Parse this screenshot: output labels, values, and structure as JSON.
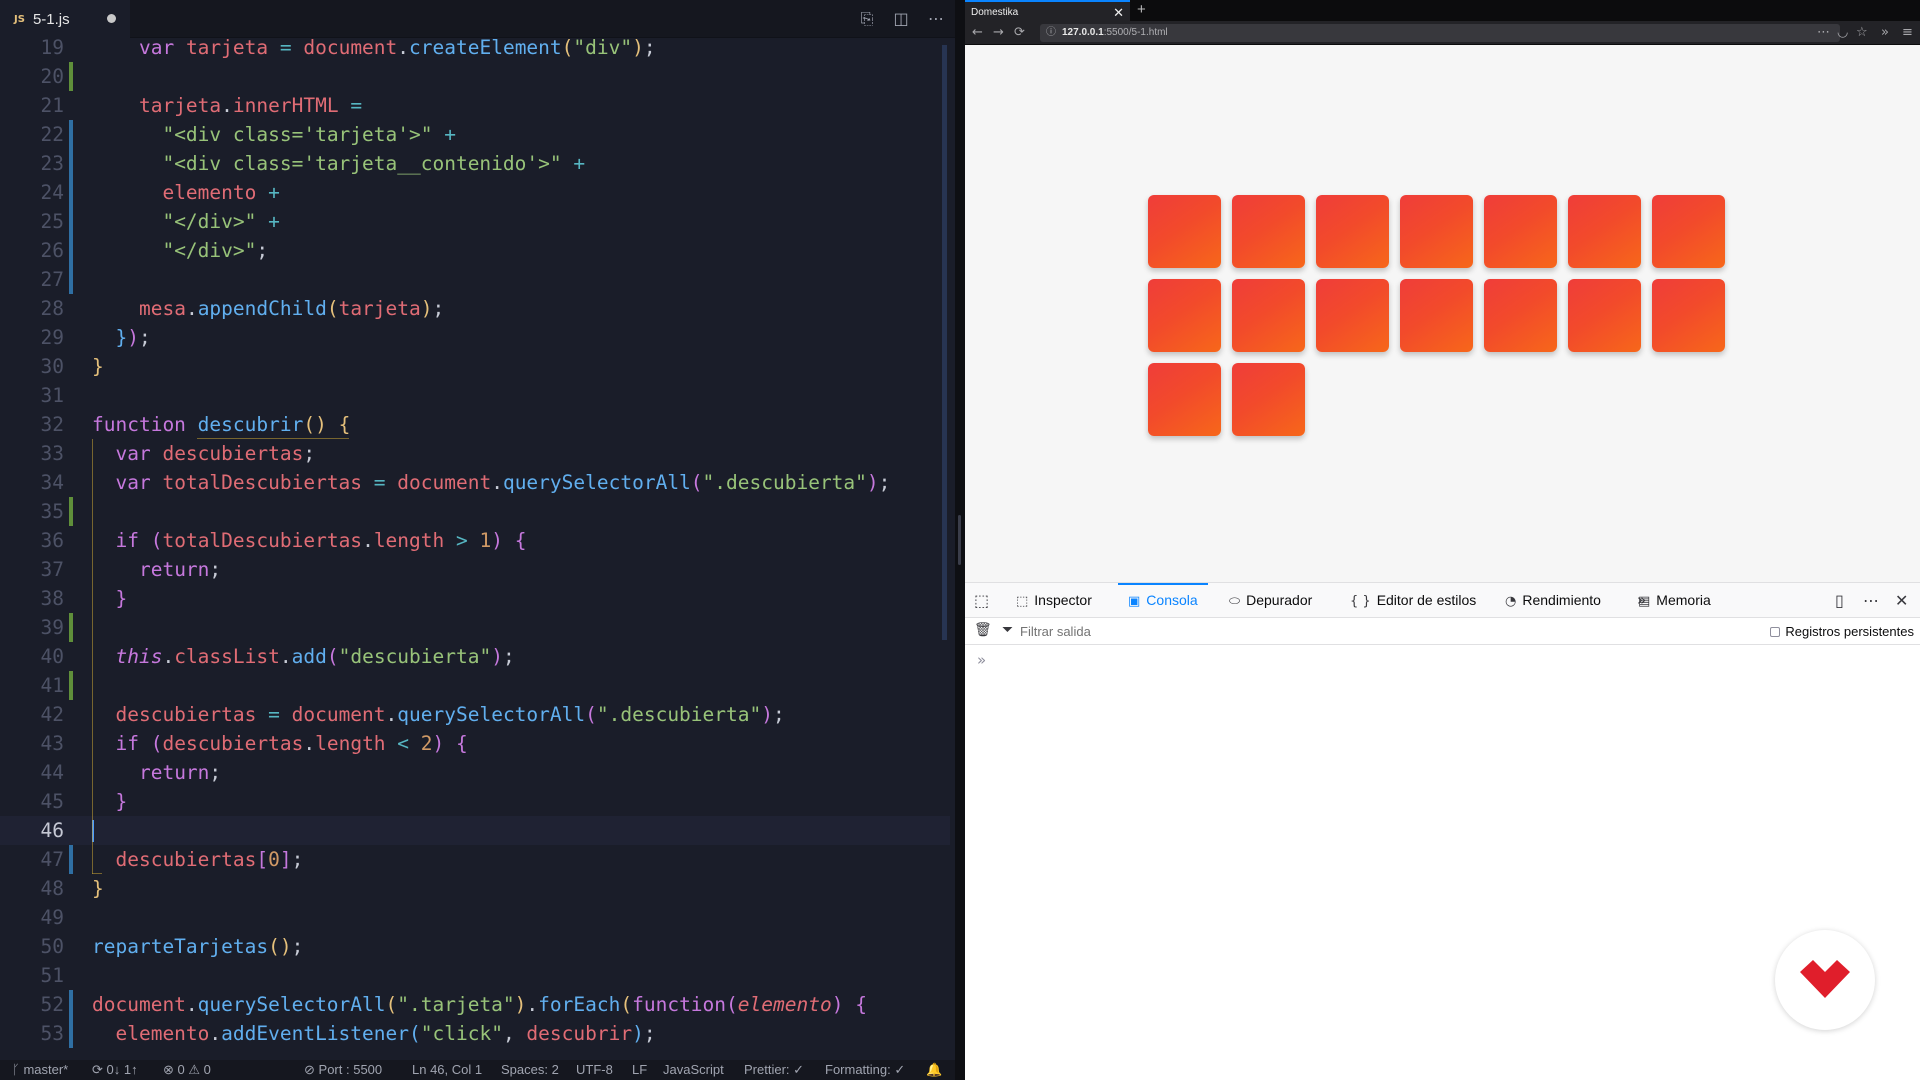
{
  "editor": {
    "tab_label": "5-1.js",
    "tab_badge": "JS",
    "tab_modified": true,
    "cursor_line": 46,
    "lines": [
      {
        "n": "19",
        "t": ""
      },
      {
        "n": "20",
        "t": ""
      },
      {
        "n": "21",
        "t": ""
      },
      {
        "n": "22",
        "t": ""
      },
      {
        "n": "23",
        "t": ""
      },
      {
        "n": "24",
        "t": ""
      },
      {
        "n": "25",
        "t": ""
      },
      {
        "n": "26",
        "t": ""
      },
      {
        "n": "27",
        "t": ""
      },
      {
        "n": "28",
        "t": ""
      },
      {
        "n": "29",
        "t": ""
      },
      {
        "n": "30",
        "t": ""
      },
      {
        "n": "31",
        "t": ""
      },
      {
        "n": "32",
        "t": ""
      },
      {
        "n": "33",
        "t": ""
      },
      {
        "n": "34",
        "t": ""
      },
      {
        "n": "35",
        "t": ""
      },
      {
        "n": "36",
        "t": ""
      },
      {
        "n": "37",
        "t": ""
      },
      {
        "n": "38",
        "t": ""
      },
      {
        "n": "39",
        "t": ""
      },
      {
        "n": "40",
        "t": ""
      },
      {
        "n": "41",
        "t": ""
      },
      {
        "n": "42",
        "t": ""
      },
      {
        "n": "43",
        "t": ""
      },
      {
        "n": "44",
        "t": ""
      },
      {
        "n": "45",
        "t": ""
      },
      {
        "n": "46",
        "t": ""
      },
      {
        "n": "47",
        "t": ""
      },
      {
        "n": "48",
        "t": ""
      },
      {
        "n": "49",
        "t": ""
      },
      {
        "n": "50",
        "t": ""
      },
      {
        "n": "51",
        "t": ""
      },
      {
        "n": "52",
        "t": ""
      },
      {
        "n": "53",
        "t": ""
      }
    ],
    "code": [
      [
        [
          "p",
          "    "
        ],
        [
          "k",
          "var "
        ],
        [
          "v",
          "tarjeta"
        ],
        [
          "o",
          " = "
        ],
        [
          "v",
          "document"
        ],
        [
          "p",
          "."
        ],
        [
          "f",
          "createElement"
        ],
        [
          "b1",
          "("
        ],
        [
          "s",
          "\"div\""
        ],
        [
          "b1",
          ")"
        ],
        [
          "p",
          ";"
        ]
      ],
      [],
      [
        [
          "p",
          "    "
        ],
        [
          "v",
          "tarjeta"
        ],
        [
          "p",
          "."
        ],
        [
          "v",
          "innerHTML"
        ],
        [
          "o",
          " ="
        ]
      ],
      [
        [
          "p",
          "      "
        ],
        [
          "s",
          "\"<div class='tarjeta'>\""
        ],
        [
          "o",
          " +"
        ]
      ],
      [
        [
          "p",
          "      "
        ],
        [
          "s",
          "\"<div class='tarjeta__contenido'>\""
        ],
        [
          "o",
          " +"
        ]
      ],
      [
        [
          "p",
          "      "
        ],
        [
          "v",
          "elemento"
        ],
        [
          "o",
          " +"
        ]
      ],
      [
        [
          "p",
          "      "
        ],
        [
          "s",
          "\"</div>\""
        ],
        [
          "o",
          " +"
        ]
      ],
      [
        [
          "p",
          "      "
        ],
        [
          "s",
          "\"</div>\""
        ],
        [
          "p",
          ";"
        ]
      ],
      [],
      [
        [
          "p",
          "    "
        ],
        [
          "v",
          "mesa"
        ],
        [
          "p",
          "."
        ],
        [
          "f",
          "appendChild"
        ],
        [
          "b1",
          "("
        ],
        [
          "v",
          "tarjeta"
        ],
        [
          "b1",
          ")"
        ],
        [
          "p",
          ";"
        ]
      ],
      [
        [
          "p",
          "  "
        ],
        [
          "b3",
          "}"
        ],
        [
          "b2",
          ")"
        ],
        [
          "p",
          ";"
        ]
      ],
      [
        [
          "b1",
          "}"
        ]
      ],
      [],
      [
        [
          "k",
          "function "
        ],
        [
          "f",
          "descubrir"
        ],
        [
          "b1",
          "() {"
        ]
      ],
      [
        [
          "p",
          "  "
        ],
        [
          "k",
          "var "
        ],
        [
          "v",
          "descubiertas"
        ],
        [
          "p",
          ";"
        ]
      ],
      [
        [
          "p",
          "  "
        ],
        [
          "k",
          "var "
        ],
        [
          "v",
          "totalDescubiertas"
        ],
        [
          "o",
          " = "
        ],
        [
          "v",
          "document"
        ],
        [
          "p",
          "."
        ],
        [
          "f",
          "querySelectorAll"
        ],
        [
          "b2",
          "("
        ],
        [
          "s",
          "\".descubierta\""
        ],
        [
          "b2",
          ")"
        ],
        [
          "p",
          ";"
        ]
      ],
      [],
      [
        [
          "p",
          "  "
        ],
        [
          "k",
          "if "
        ],
        [
          "b2",
          "("
        ],
        [
          "v",
          "totalDescubiertas"
        ],
        [
          "p",
          "."
        ],
        [
          "v",
          "length"
        ],
        [
          "o",
          " > "
        ],
        [
          "n",
          "1"
        ],
        [
          "b2",
          ") {"
        ]
      ],
      [
        [
          "p",
          "    "
        ],
        [
          "k",
          "return"
        ],
        [
          "p",
          ";"
        ]
      ],
      [
        [
          "p",
          "  "
        ],
        [
          "b2",
          "}"
        ]
      ],
      [],
      [
        [
          "p",
          "  "
        ],
        [
          "pr",
          "this"
        ],
        [
          "p",
          "."
        ],
        [
          "v",
          "classList"
        ],
        [
          "p",
          "."
        ],
        [
          "f",
          "add"
        ],
        [
          "b2",
          "("
        ],
        [
          "s",
          "\"descubierta\""
        ],
        [
          "b2",
          ")"
        ],
        [
          "p",
          ";"
        ]
      ],
      [],
      [
        [
          "p",
          "  "
        ],
        [
          "v",
          "descubiertas"
        ],
        [
          "o",
          " = "
        ],
        [
          "v",
          "document"
        ],
        [
          "p",
          "."
        ],
        [
          "f",
          "querySelectorAll"
        ],
        [
          "b2",
          "("
        ],
        [
          "s",
          "\".descubierta\""
        ],
        [
          "b2",
          ")"
        ],
        [
          "p",
          ";"
        ]
      ],
      [
        [
          "p",
          "  "
        ],
        [
          "k",
          "if "
        ],
        [
          "b2",
          "("
        ],
        [
          "v",
          "descubiertas"
        ],
        [
          "p",
          "."
        ],
        [
          "v",
          "length"
        ],
        [
          "o",
          " < "
        ],
        [
          "n",
          "2"
        ],
        [
          "b2",
          ") {"
        ]
      ],
      [
        [
          "p",
          "    "
        ],
        [
          "k",
          "return"
        ],
        [
          "p",
          ";"
        ]
      ],
      [
        [
          "p",
          "  "
        ],
        [
          "b2",
          "}"
        ]
      ],
      [],
      [
        [
          "p",
          "  "
        ],
        [
          "v",
          "descubiertas"
        ],
        [
          "b2",
          "["
        ],
        [
          "n",
          "0"
        ],
        [
          "b2",
          "]"
        ],
        [
          "p",
          ";"
        ]
      ],
      [
        [
          "b1",
          "}"
        ]
      ],
      [],
      [
        [
          "f",
          "reparteTarjetas"
        ],
        [
          "b1",
          "()"
        ],
        [
          "p",
          ";"
        ]
      ],
      [],
      [
        [
          "v",
          "document"
        ],
        [
          "p",
          "."
        ],
        [
          "f",
          "querySelectorAll"
        ],
        [
          "b1",
          "("
        ],
        [
          "s",
          "\".tarjeta\""
        ],
        [
          "b1",
          ")"
        ],
        [
          "p",
          "."
        ],
        [
          "f",
          "forEach"
        ],
        [
          "b1",
          "("
        ],
        [
          "k",
          "function"
        ],
        [
          "b2",
          "("
        ],
        [
          "t",
          "elemento"
        ],
        [
          "b2",
          ")"
        ],
        [
          "b2",
          " {"
        ]
      ],
      [
        [
          "p",
          "  "
        ],
        [
          "v",
          "elemento"
        ],
        [
          "p",
          "."
        ],
        [
          "f",
          "addEventListener"
        ],
        [
          "b3",
          "("
        ],
        [
          "s",
          "\"click\""
        ],
        [
          "p",
          ", "
        ],
        [
          "v",
          "descubrir"
        ],
        [
          "b3",
          ")"
        ],
        [
          "p",
          ";"
        ]
      ]
    ]
  },
  "statusbar": {
    "branch": "master*",
    "sync": "0↓ 1↑",
    "problems": "⊗ 0 ⚠ 0",
    "port": "Port : 5500",
    "position": "Ln 46, Col 1",
    "spaces": "Spaces: 2",
    "encoding": "UTF-8",
    "eol": "LF",
    "language": "JavaScript",
    "prettier": "Prettier: ✓",
    "formatting": "Formatting: ✓"
  },
  "browser": {
    "tab_title": "Domestika",
    "url_host": "127.0.0.1",
    "url_rest": ":5500/5-1.html",
    "cards_per_row": 7,
    "card_count": 16,
    "card_color_start": "#ef3d3a",
    "card_color_end": "#f7671a"
  },
  "devtools": {
    "tabs": [
      {
        "label": "Inspector",
        "icon": "inspector-icon",
        "selected": false
      },
      {
        "label": "Consola",
        "icon": "console-icon",
        "selected": true
      },
      {
        "label": "Depurador",
        "icon": "debugger-icon",
        "selected": false
      },
      {
        "label": "Editor de estilos",
        "icon": "style-editor-icon",
        "selected": false
      },
      {
        "label": "Rendimiento",
        "icon": "performance-icon",
        "selected": false
      },
      {
        "label": "Memoria",
        "icon": "memory-icon",
        "selected": false
      }
    ],
    "filter_placeholder": "Filtrar salida",
    "persist_label": "Registros persistentes",
    "accent": "#0a84ff"
  }
}
